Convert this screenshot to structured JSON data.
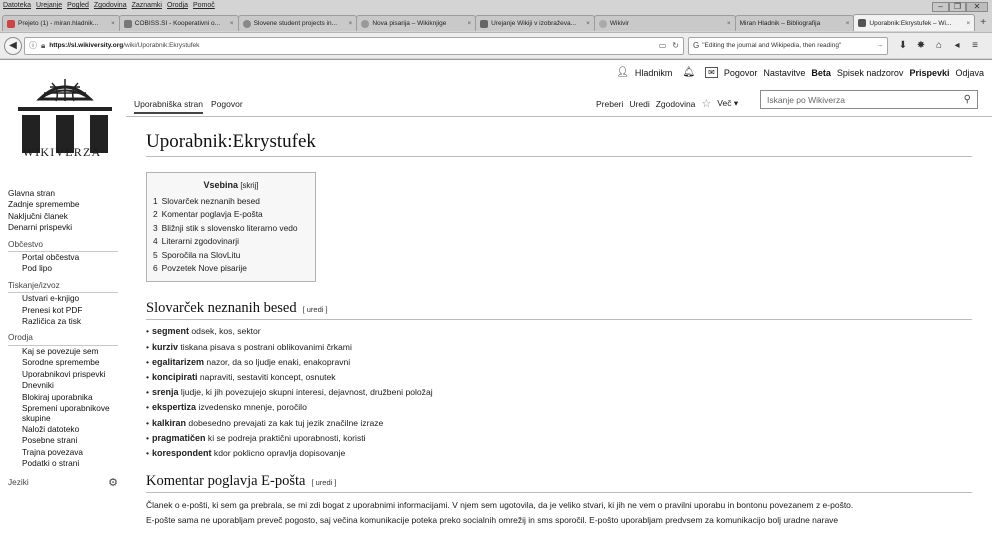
{
  "browser": {
    "menu": [
      "Datoteka",
      "Urejanje",
      "Pogled",
      "Zgodovina",
      "Zaznamki",
      "Orodja",
      "Pomoč"
    ],
    "window_controls": [
      "–",
      "❐",
      "✕"
    ],
    "tabs": [
      {
        "label": "Prejeto (1) - miran.hladnik...",
        "active": false
      },
      {
        "label": "COBISS.SI - Kooperativni o...",
        "active": false
      },
      {
        "label": "Slovene student projects in...",
        "active": false
      },
      {
        "label": "Nova pisarija – Wikiknjige",
        "active": false
      },
      {
        "label": "Urejanje Wikiji v izobraževa...",
        "active": false
      },
      {
        "label": "Wikivir",
        "active": false
      },
      {
        "label": "Miran Hladnik – Bibliografija",
        "active": false
      },
      {
        "label": "Uporabnik:Ekrystufek – Wi...",
        "active": true
      }
    ],
    "new_tab": "+",
    "url_host": "https://sl.wikiversity.org",
    "url_path": "/wiki/Uporabnik:Ekrystufek",
    "search_value": "\"Editing the journal and Wikipedia, then reading\""
  },
  "wiki": {
    "personal": {
      "user": "Hladnikm",
      "items": [
        "Pogovor",
        "Nastavitve",
        "Beta",
        "Spisek nadzorov",
        "Prispevki",
        "Odjava"
      ]
    },
    "logo_text": "WIKIVERZA",
    "tabs_left": [
      "Uporabniška stran",
      "Pogovor"
    ],
    "tabs_right": [
      "Preberi",
      "Uredi",
      "Zgodovina"
    ],
    "more_label": "Več",
    "search_placeholder": "Iskanje po Wikiverza",
    "sidebar": {
      "main": [
        "Glavna stran",
        "Zadnje spremembe",
        "Naključni članek",
        "Denarni prispevki"
      ],
      "groups": [
        {
          "heading": "Občestvo",
          "items": [
            "Portal občestva",
            "Pod lipo"
          ]
        },
        {
          "heading": "Tiskanje/izvoz",
          "items": [
            "Ustvari e-knjigo",
            "Prenesi kot PDF",
            "Različica za tisk"
          ]
        },
        {
          "heading": "Orodja",
          "items": [
            "Kaj se povezuje sem",
            "Sorodne spremembe",
            "Uporabnikovi prispevki",
            "Dnevniki",
            "Blokiraj uporabnika",
            "Spremeni uporabnikove skupine",
            "Naloži datoteko",
            "Posebne strani",
            "Trajna povezava",
            "Podatki o strani"
          ]
        }
      ],
      "languages": "Jeziki"
    },
    "title": "Uporabnik:Ekrystufek",
    "toc": {
      "title": "Vsebina",
      "toggle": "[skrij]",
      "items": [
        {
          "num": "1",
          "label": "Slovarček neznanih besed"
        },
        {
          "num": "2",
          "label": "Komentar poglavja E-pošta"
        },
        {
          "num": "3",
          "label": "Bližnji stik s slovensko literarno vedo"
        },
        {
          "num": "4",
          "label": "Literarni zgodovinarji"
        },
        {
          "num": "5",
          "label": "Sporočila na SlovLitu"
        },
        {
          "num": "6",
          "label": "Povzetek Nove pisarije"
        }
      ]
    },
    "edit_label": "[ uredi ]",
    "section1": {
      "heading": "Slovarček neznanih besed",
      "terms": [
        {
          "term": "segment",
          "def": " odsek, kos, sektor"
        },
        {
          "term": "kurziv",
          "def": " tiskana pisava s postrani oblikovanimi črkami"
        },
        {
          "term": "egalitarizem",
          "def": " nazor, da so ljudje enaki, enakopravni"
        },
        {
          "term": "koncipirati",
          "def": " napraviti, sestaviti koncept, osnutek"
        },
        {
          "term": "srenja",
          "def": " ljudje, ki jih povezujejo skupni interesi, dejavnost, družbeni položaj"
        },
        {
          "term": "ekspertiza",
          "def": " izvedensko mnenje, poročilo"
        },
        {
          "term": "kalkiran",
          "def": " dobesedno prevajati za kak tuj jezik značilne izraze"
        },
        {
          "term": "pragmatičen",
          "def": " ki se podreja praktični uporabnosti, koristi"
        },
        {
          "term": "korespondent",
          "def": " kdor poklicno opravlja dopisovanje"
        }
      ]
    },
    "section2": {
      "heading": "Komentar poglavja E-pošta",
      "para1": "Članek o e-pošti, ki sem ga prebrala, se mi zdi bogat z uporabnimi informacijami. V njem sem ugotovila, da je veliko stvari, ki jih ne vem o pravilni uporabu in bontonu povezanem z e-pošto.",
      "para2": "E-pošte sama ne uporabljam preveč pogosto, saj večina komunikacije poteka preko socialnih omrežij in sms sporočil. E-pošto uporabljam predvsem za komunikacijo bolj uradne narave"
    }
  }
}
